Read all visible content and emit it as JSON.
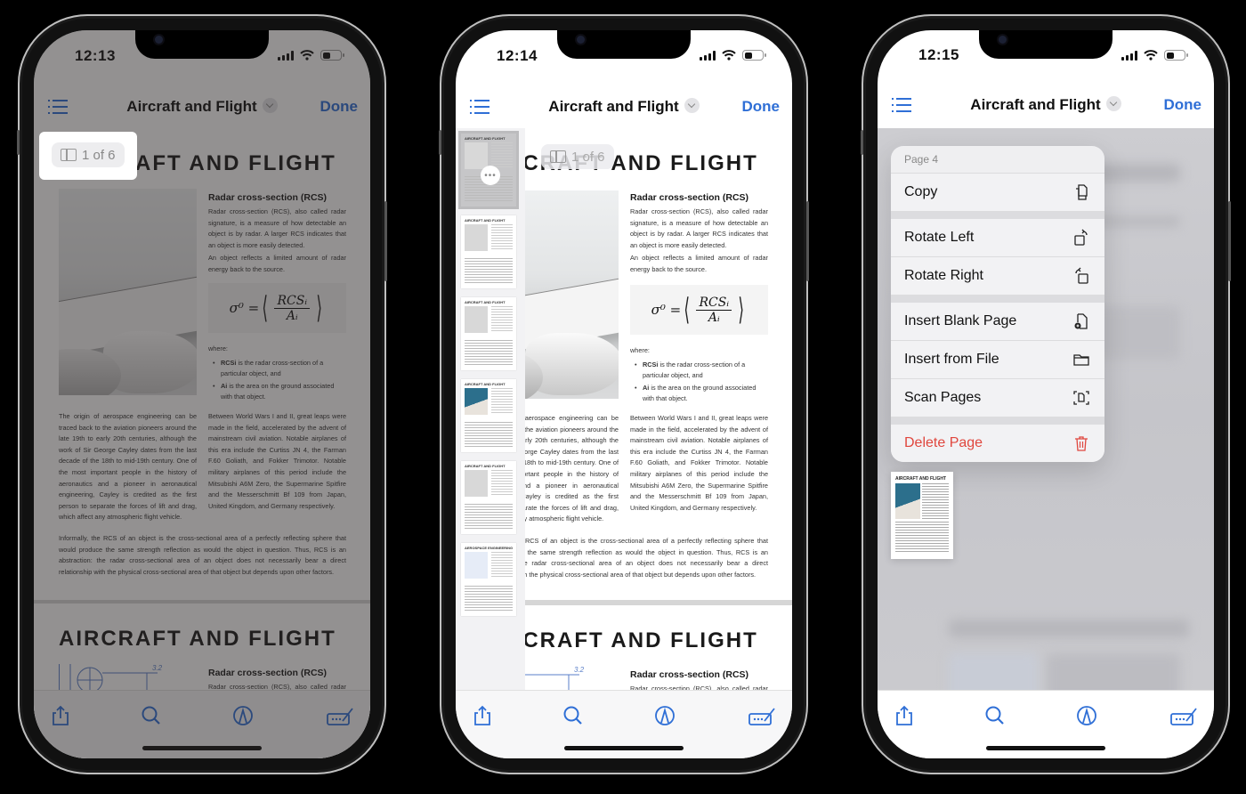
{
  "document": {
    "page_title": "AIRCRAFT AND  FLIGHT",
    "section_heading": "Radar cross-section (RCS)",
    "rcs_intro": "Radar cross-section (RCS), also called radar signature, is a measure of how detectable an object is by radar.  A larger RCS indicates that an object is more easily detected.",
    "rcs_reflects": "An object reflects a  limited amount of radar energy back to the source.",
    "formula": {
      "lhs": "σ⁰ =",
      "numerator": "RCSᵢ",
      "denominator": "Aᵢ"
    },
    "where_label": "where:",
    "bullets": [
      {
        "term": "RCSi",
        "text": " is the radar cross-section of a particular object, and"
      },
      {
        "term": "Ai",
        "text": " is the area on the ground associated with that object."
      }
    ],
    "history_left": "The origin of aerospace engineering can be traced back to the aviation pioneers around the late 19th to early 20th centuries, although the work of Sir George Cayley dates from the last decade of the 18th to mid-19th century. One of the most important people in the history of aeronautics and a pioneer in aeronautical engineering, Cayley is credited as the first person to separate the forces of lift and drag, which affect any atmospheric flight vehicle.",
    "history_right": "Between World Wars I and II, great leaps were made in the field, accelerated by the advent of mainstream civil aviation. Notable airplanes of this era include the Curtiss JN 4, the Farman F.60 Goliath, and Fokker Trimotor. Notable military airplanes of this period include the Mitsubishi A6M Zero, the Supermarine Spitfire and the Messerschmitt Bf 109 from Japan, United Kingdom, and Germany respectively.",
    "informal": "Informally, the RCS of an object is the cross-sectional area of a perfectly reflecting sphere that would produce the same strength reflection as would the object in question. Thus, RCS is an abstraction: the radar cross-sectional area of an object does not necessarily bear a direct relationship with the physical cross-sectional area of that object but depends upon other factors.",
    "page2_title": "AIRCRAFT AND  FLIGHT",
    "page2_heading": "Radar cross-section (RCS)",
    "page2_intro": "Radar cross-section (RCS), also called radar signature, is a measure of how detectable an",
    "blueprint_label": "3.2"
  },
  "nav": {
    "title": "Aircraft and  Flight",
    "done_label": "Done",
    "list_icon": "list-icon",
    "chevron_icon": "chevron-down-icon"
  },
  "page_indicator": "1 of 6",
  "thumbnails": [
    {
      "title": "AIRCRAFT AND FLIGHT",
      "selected": true
    },
    {
      "title": "AIRCRAFT AND FLIGHT"
    },
    {
      "title": "AIRCRAFT AND FLIGHT"
    },
    {
      "title": "AIRCRAFT AND FLIGHT"
    },
    {
      "title": "AIRCRAFT AND FLIGHT"
    },
    {
      "title": "AEROSPACE ENGINEERING"
    }
  ],
  "more_button": "•••",
  "phones": [
    {
      "time": "12:13"
    },
    {
      "time": "12:14"
    },
    {
      "time": "12:15"
    }
  ],
  "toolbar": {
    "share": "share-icon",
    "search": "search-icon",
    "markup": "markup-pen-icon",
    "form": "form-fill-icon"
  },
  "context_menu": {
    "header": "Page 4",
    "groups": [
      [
        {
          "label": "Copy",
          "icon": "copy-icon"
        }
      ],
      [
        {
          "label": "Rotate Left",
          "icon": "rotate-left-icon"
        },
        {
          "label": "Rotate Right",
          "icon": "rotate-right-icon"
        }
      ],
      [
        {
          "label": "Insert Blank Page",
          "icon": "insert-blank-page-icon"
        },
        {
          "label": "Insert from File",
          "icon": "folder-icon"
        },
        {
          "label": "Scan Pages",
          "icon": "scan-icon"
        }
      ],
      [
        {
          "label": "Delete Page",
          "icon": "trash-icon",
          "destructive": true
        }
      ]
    ]
  },
  "mini_page": {
    "title": "AIRCRAFT AND  FLIGHT"
  },
  "colors": {
    "accent": "#2f6fd6",
    "destructive": "#e0463d",
    "dim_overlay": "#5a5555"
  }
}
